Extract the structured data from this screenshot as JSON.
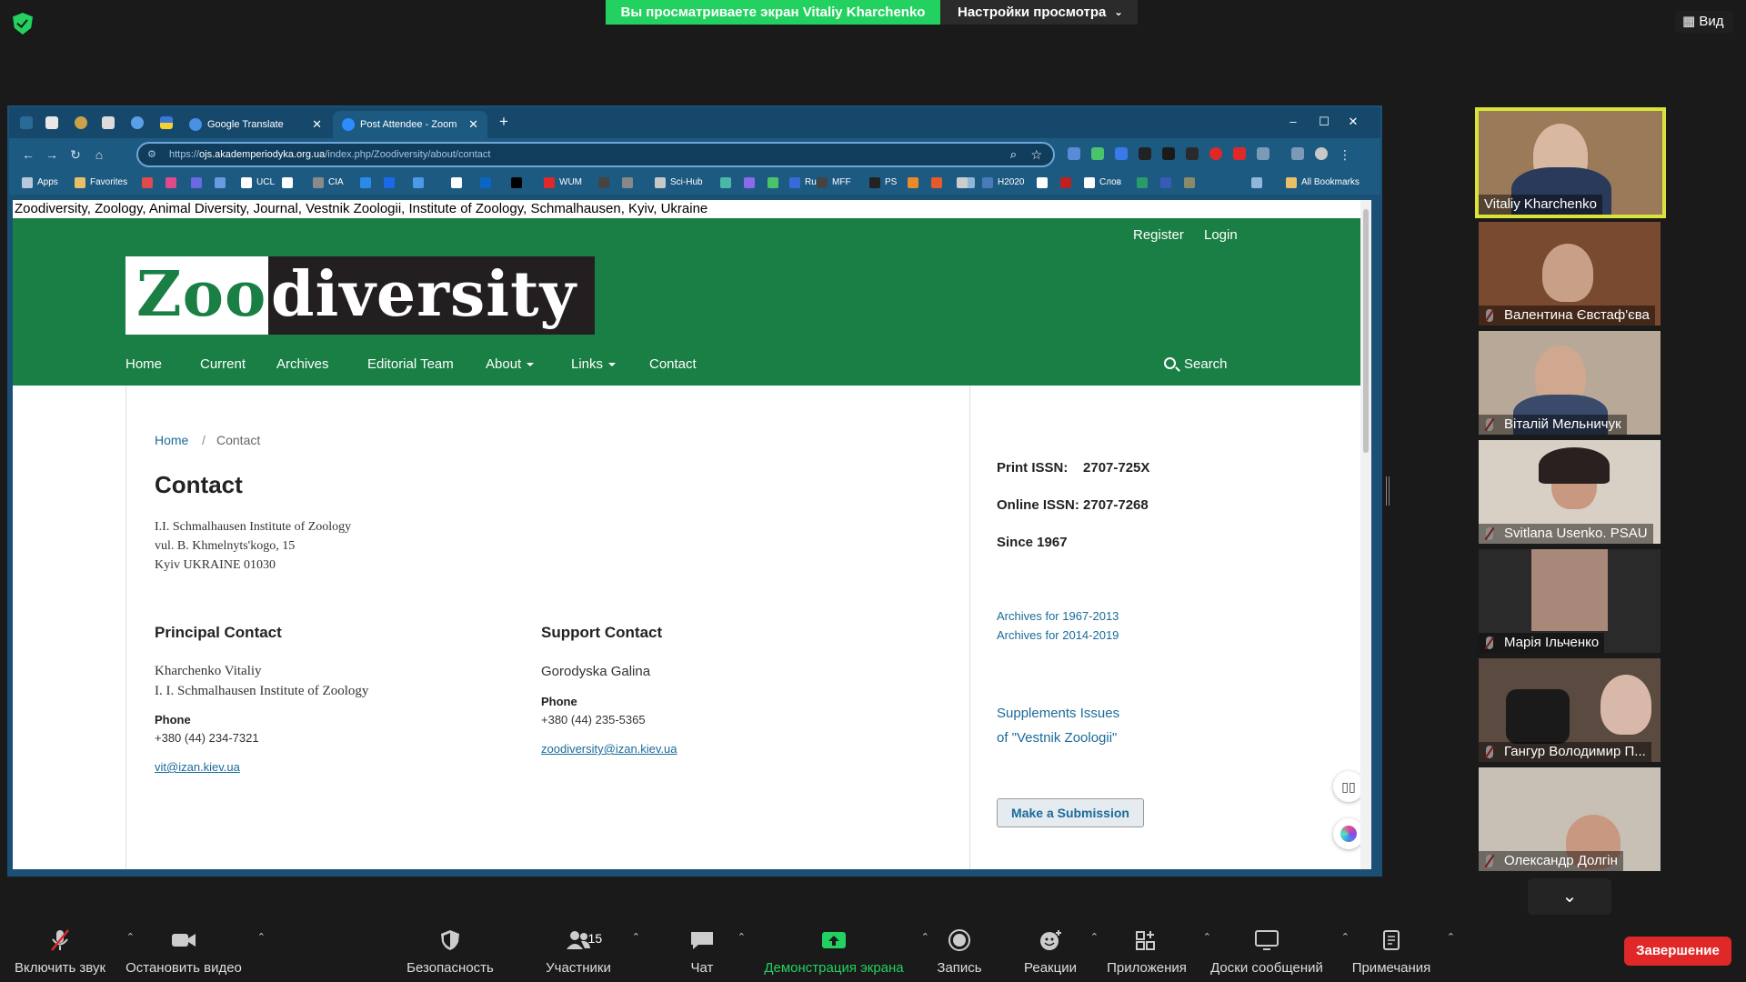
{
  "zoom": {
    "viewing_banner": "Вы просматриваете экран Vitaliy Kharchenko",
    "view_settings": "Настройки просмотра",
    "view_button": "Вид",
    "end_button": "Завершение",
    "toolbar": {
      "mute": "Включить звук",
      "video": "Остановить видео",
      "security": "Безопасность",
      "participants": "Участники",
      "participants_count": "15",
      "chat": "Чат",
      "share": "Демонстрация экрана",
      "record": "Запись",
      "reactions": "Реакции",
      "apps": "Приложения",
      "whiteboards": "Доски сообщений",
      "notes": "Примечания"
    },
    "participants": [
      {
        "name": "Vitaliy Kharchenko"
      },
      {
        "name": "Валентина Євстаф'єва"
      },
      {
        "name": "Віталій Мельничук"
      },
      {
        "name": "Svitlana Usenko. PSAU"
      },
      {
        "name": "Марія Ільченко"
      },
      {
        "name": "Гангур Володимир П..."
      },
      {
        "name": "Олександр Долгін"
      }
    ]
  },
  "browser": {
    "tabs": [
      {
        "label": "Google Translate"
      },
      {
        "label": "Post Attendee - Zoom"
      }
    ],
    "new_tab": "+",
    "url_prefix": "https://",
    "url_host": "ojs.akademperiodyka.org.ua",
    "url_path": "/index.php/Zoodiversity/about/contact",
    "bookmarks": [
      "Apps",
      "Favorites",
      "UCL",
      "CIA",
      "WUM",
      "Sci-Hub",
      "Ru",
      "MFF",
      "PS",
      "H2020",
      "Слов"
    ],
    "all_bookmarks": "All Bookmarks"
  },
  "page": {
    "window_title": "Zoodiversity, Zoology, Animal Diversity, Journal, Vestnik Zoologii, Institute of Zoology, Schmalhausen, Kyiv, Ukraine",
    "register": "Register",
    "login": "Login",
    "logo_zoo": "Zoo",
    "logo_diversity": "diversity",
    "nav": [
      "Home",
      "Current",
      "Archives",
      "Editorial Team",
      "About",
      "Links",
      "Contact"
    ],
    "search": "Search",
    "breadcrumb": {
      "home": "Home",
      "sep": "/",
      "current": "Contact"
    },
    "heading": "Contact",
    "address": [
      "I.I. Schmalhausen Institute of Zoology",
      "vul. B. Khmelnyts'kogo, 15",
      "Kyiv UKRAINE 01030"
    ],
    "principal": {
      "title": "Principal Contact",
      "name": "Kharchenko Vitaliy",
      "affiliation": "I. I. Schmalhausen Institute of Zoology",
      "phone_label": "Phone",
      "phone": "+380 (44) 234-7321",
      "email": "vit@izan.kiev.ua"
    },
    "support": {
      "title": "Support Contact",
      "name": "Gorodyska Galina",
      "phone_label": "Phone",
      "phone": "+380 (44) 235-5365",
      "email": "zoodiversity@izan.kiev.ua"
    },
    "sidebar": {
      "print_issn": "Print ISSN:    2707-725X",
      "online_issn": "Online ISSN: 2707-7268",
      "since": "Since 1967",
      "archives_1": "Archives for 1967-2013",
      "archives_2": "Archives for 2014-2019",
      "supplements_1": "Supplements Issues",
      "supplements_2": "of \"Vestnik Zoologii\"",
      "submit": "Make a Submission"
    }
  }
}
